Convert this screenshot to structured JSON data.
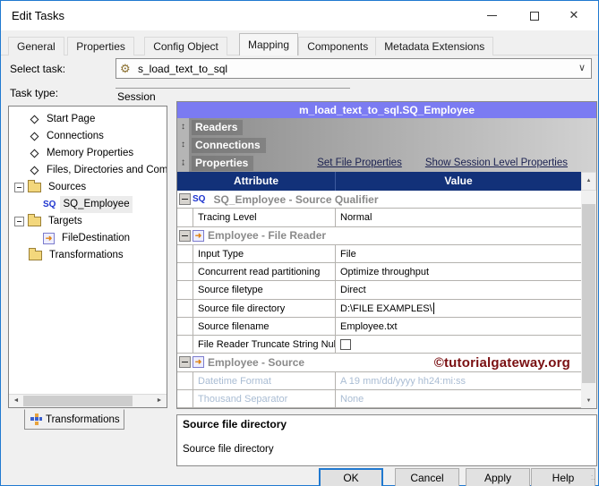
{
  "window": {
    "title": "Edit Tasks",
    "controls": [
      "minimize",
      "maximize",
      "close"
    ]
  },
  "tabs": {
    "items": [
      "General",
      "Properties",
      "Config Object",
      "Mapping",
      "Components",
      "Metadata Extensions"
    ],
    "active": "Mapping"
  },
  "form": {
    "select_task": {
      "label": "Select task:",
      "value": "s_load_text_to_sql"
    },
    "task_type": {
      "label": "Task type:",
      "value": "Session"
    }
  },
  "tree": {
    "items": [
      {
        "label": "Start Page",
        "icon": "diamond",
        "indent": 1
      },
      {
        "label": "Connections",
        "icon": "diamond",
        "indent": 1
      },
      {
        "label": "Memory Properties",
        "icon": "diamond",
        "indent": 1
      },
      {
        "label": "Files, Directories and Com",
        "icon": "diamond",
        "indent": 1
      },
      {
        "label": "Sources",
        "icon": "folder",
        "expander": "minus",
        "indent": 0
      },
      {
        "label": "SQ_Employee",
        "icon": "sq",
        "indent": 2,
        "selected": true
      },
      {
        "label": "Targets",
        "icon": "folder",
        "expander": "minus",
        "indent": 0
      },
      {
        "label": "FileDestination",
        "icon": "filetarget",
        "indent": 2
      },
      {
        "label": "Transformations",
        "icon": "folder",
        "indent": 1
      }
    ]
  },
  "bottom_tab": {
    "label": "Transformations"
  },
  "panel": {
    "title": "m_load_text_to_sql.SQ_Employee",
    "sections": [
      {
        "label": "Readers"
      },
      {
        "label": "Connections"
      },
      {
        "label": "Properties",
        "links": [
          "Set File Properties",
          "Show Session Level Properties"
        ]
      }
    ],
    "grid": {
      "headers": [
        "Attribute",
        "Value"
      ],
      "rows": [
        {
          "type": "group",
          "icon": "sq",
          "label": "SQ_Employee - Source Qualifier"
        },
        {
          "type": "prop",
          "attribute": "Tracing Level",
          "value": "Normal"
        },
        {
          "type": "group",
          "icon": "filereader",
          "label": "Employee - File Reader"
        },
        {
          "type": "prop",
          "attribute": "Input Type",
          "value": "File"
        },
        {
          "type": "prop",
          "attribute": "Concurrent read partitioning",
          "value": "Optimize throughput"
        },
        {
          "type": "prop",
          "attribute": "Source filetype",
          "value": "Direct"
        },
        {
          "type": "prop",
          "attribute": "Source file directory",
          "value": "D:\\FILE EXAMPLES\\",
          "cursor": true
        },
        {
          "type": "prop",
          "attribute": "Source filename",
          "value": "Employee.txt"
        },
        {
          "type": "prop",
          "attribute": "File Reader Truncate String Null",
          "value": "",
          "checkbox": "unchecked"
        },
        {
          "type": "group",
          "icon": "filereader",
          "label": "Employee - Source",
          "watermark": "©tutorialgateway.org"
        },
        {
          "type": "prop",
          "attribute": "Datetime Format",
          "value": "A  19 mm/dd/yyyy hh24:mi:ss",
          "disabled": true
        },
        {
          "type": "prop",
          "attribute": "Thousand Separator",
          "value": "None",
          "disabled": true
        }
      ]
    }
  },
  "description": {
    "title": "Source file directory",
    "text": "Source file directory"
  },
  "buttons": [
    {
      "label": "OK",
      "default": true
    },
    {
      "label": "Cancel"
    },
    {
      "label": "Apply"
    },
    {
      "label": "Help"
    }
  ],
  "colors": {
    "window_border": "#2079d0",
    "panel_title_bg": "#7b7bf2",
    "grid_header_bg": "#123179",
    "group_text": "#8a8a8a",
    "disabled_text": "#a9bcd3",
    "watermark": "#7a1012",
    "link": "#1b2150"
  }
}
